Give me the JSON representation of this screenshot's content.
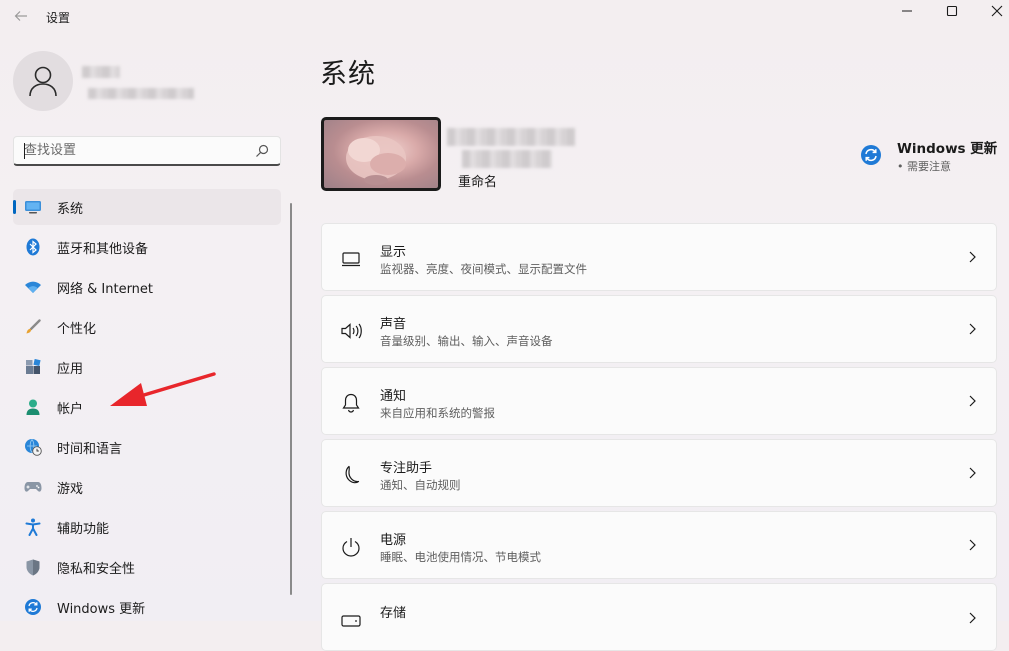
{
  "window": {
    "title": "设置",
    "controls": [
      "minimize",
      "maximize",
      "close"
    ]
  },
  "search": {
    "placeholder": "查找设置"
  },
  "sidebar": {
    "items": [
      {
        "label": "系统",
        "icon": "monitor-icon",
        "active": true
      },
      {
        "label": "蓝牙和其他设备",
        "icon": "bluetooth-icon",
        "active": false
      },
      {
        "label": "网络 & Internet",
        "icon": "wifi-icon",
        "active": false
      },
      {
        "label": "个性化",
        "icon": "brush-icon",
        "active": false
      },
      {
        "label": "应用",
        "icon": "apps-icon",
        "active": false
      },
      {
        "label": "帐户",
        "icon": "person-icon",
        "active": false
      },
      {
        "label": "时间和语言",
        "icon": "globe-clock-icon",
        "active": false
      },
      {
        "label": "游戏",
        "icon": "gamepad-icon",
        "active": false
      },
      {
        "label": "辅助功能",
        "icon": "accessibility-icon",
        "active": false
      },
      {
        "label": "隐私和安全性",
        "icon": "shield-icon",
        "active": false
      },
      {
        "label": "Windows 更新",
        "icon": "update-icon",
        "active": false
      }
    ]
  },
  "main": {
    "title": "系统",
    "device": {
      "rename": "重命名"
    },
    "windows_update": {
      "title": "Windows 更新",
      "status": "• 需要注意"
    },
    "cards": [
      {
        "title": "显示",
        "subtitle": "监视器、亮度、夜间模式、显示配置文件",
        "icon": "display-icon"
      },
      {
        "title": "声音",
        "subtitle": "音量级别、输出、输入、声音设备",
        "icon": "speaker-icon"
      },
      {
        "title": "通知",
        "subtitle": "来自应用和系统的警报",
        "icon": "bell-icon"
      },
      {
        "title": "专注助手",
        "subtitle": "通知、自动规则",
        "icon": "moon-icon"
      },
      {
        "title": "电源",
        "subtitle": "睡眠、电池使用情况、节电模式",
        "icon": "power-icon"
      },
      {
        "title": "存储",
        "subtitle": "",
        "icon": "storage-icon"
      }
    ]
  },
  "colors": {
    "accent": "#0067c0",
    "annotation_arrow": "#e8262b"
  }
}
